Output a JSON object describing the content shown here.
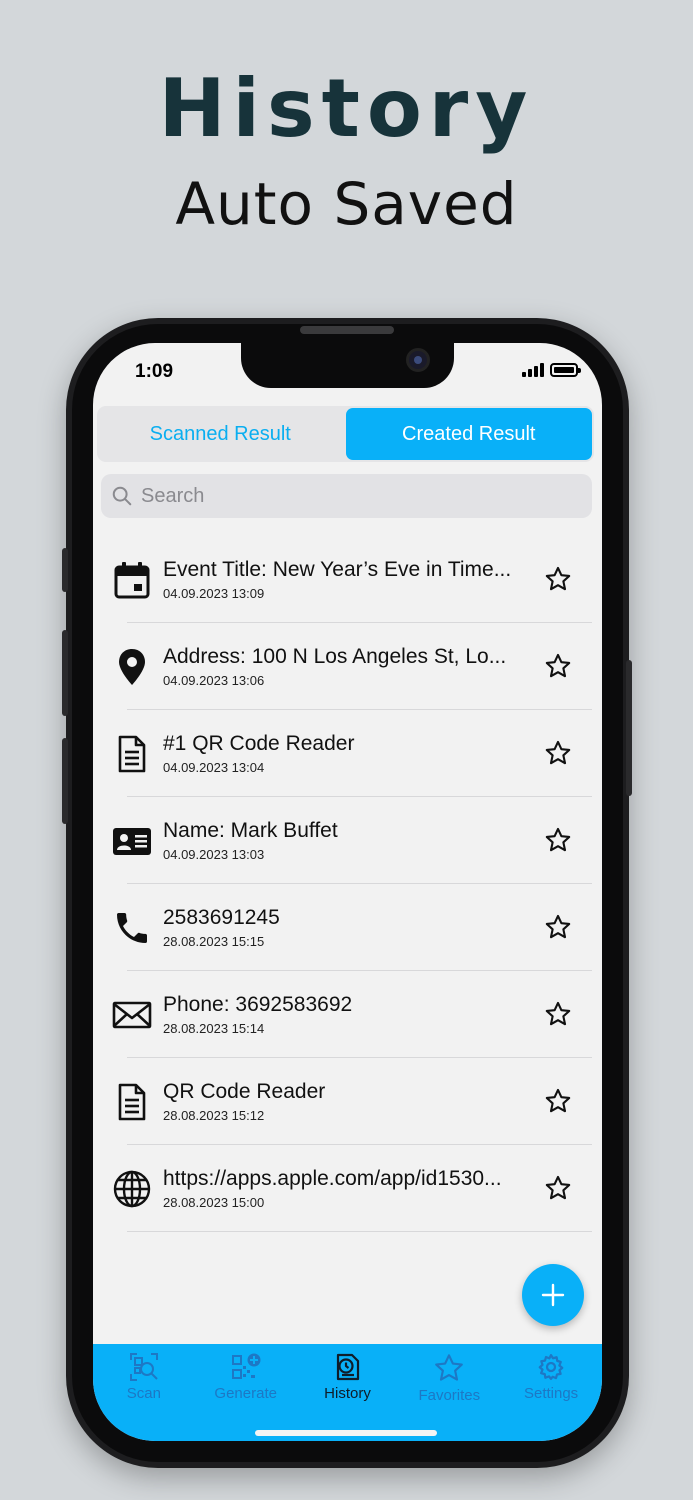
{
  "promo": {
    "headline": "History",
    "subline": "Auto Saved"
  },
  "status": {
    "time": "1:09"
  },
  "segments": [
    {
      "label": "Scanned Result",
      "selected": false
    },
    {
      "label": "Created Result",
      "selected": true
    }
  ],
  "search": {
    "placeholder": "Search"
  },
  "items": [
    {
      "icon": "calendar-icon",
      "title": "Event Title: New Year’s Eve in Time...",
      "date": "04.09.2023 13:09"
    },
    {
      "icon": "location-pin-icon",
      "title": "Address: 100 N Los Angeles St, Lo...",
      "date": "04.09.2023 13:06"
    },
    {
      "icon": "document-icon",
      "title": "#1 QR Code Reader",
      "date": "04.09.2023 13:04"
    },
    {
      "icon": "contact-card-icon",
      "title": "Name: Mark Buffet",
      "date": "04.09.2023 13:03"
    },
    {
      "icon": "phone-icon",
      "title": "2583691245",
      "date": "28.08.2023 15:15"
    },
    {
      "icon": "envelope-icon",
      "title": "Phone: 3692583692",
      "date": "28.08.2023 15:14"
    },
    {
      "icon": "document-icon",
      "title": "QR Code Reader",
      "date": "28.08.2023 15:12"
    },
    {
      "icon": "globe-icon",
      "title": "https://apps.apple.com/app/id1530...",
      "date": "28.08.2023 15:00"
    }
  ],
  "tabs": [
    {
      "label": "Scan",
      "icon": "scan-icon",
      "active": false
    },
    {
      "label": "Generate",
      "icon": "qr-generate-icon",
      "active": false
    },
    {
      "label": "History",
      "icon": "history-icon",
      "active": true
    },
    {
      "label": "Favorites",
      "icon": "star-icon",
      "active": false
    },
    {
      "label": "Settings",
      "icon": "gear-icon",
      "active": false
    }
  ],
  "colors": {
    "accent": "#09b0f8",
    "background": "#d3d7da",
    "headline": "#17333a"
  }
}
